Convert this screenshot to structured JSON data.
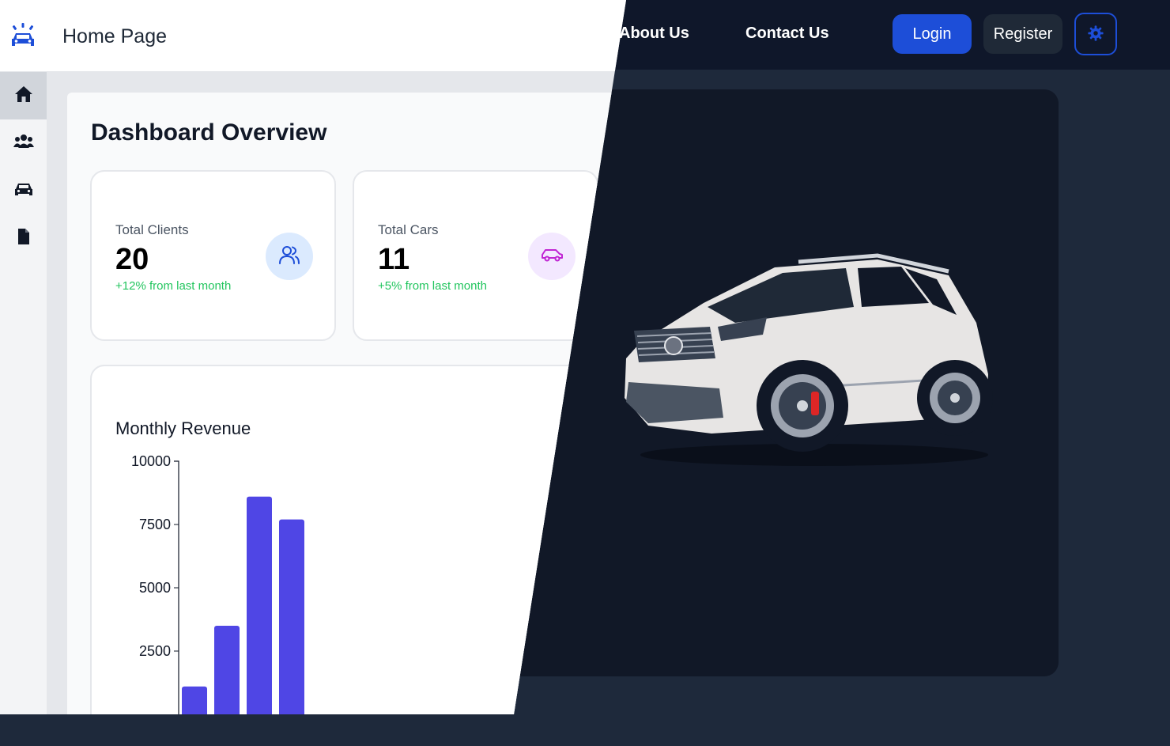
{
  "header": {
    "title": "Home Page",
    "nav": [
      {
        "label": "About Us"
      },
      {
        "label": "Contact Us"
      }
    ],
    "login_label": "Login",
    "register_label": "Register",
    "theme_icon": "gear-icon"
  },
  "sidebar": {
    "items": [
      {
        "name": "home",
        "icon": "home-icon",
        "active": true
      },
      {
        "name": "clients",
        "icon": "users-icon",
        "active": false
      },
      {
        "name": "cars",
        "icon": "car-icon",
        "active": false
      },
      {
        "name": "documents",
        "icon": "file-icon",
        "active": false
      }
    ]
  },
  "dashboard": {
    "title": "Dashboard Overview",
    "stats": [
      {
        "label": "Total Clients",
        "value": "20",
        "change": "+12% from last month",
        "icon": "users-icon"
      },
      {
        "label": "Total Cars",
        "value": "11",
        "change": "+5% from last month",
        "icon": "car-icon"
      }
    ],
    "revenue_title": "Monthly Revenue"
  },
  "chart_data": {
    "type": "bar",
    "title": "Monthly Revenue",
    "xlabel": "",
    "ylabel": "",
    "ylim": [
      0,
      10000
    ],
    "yticks": [
      10000,
      7500,
      5000,
      2500
    ],
    "values": [
      1100,
      3500,
      8600,
      7700
    ],
    "color": "#4f46e5",
    "grid": false
  },
  "colors": {
    "accent_blue": "#1d4ed8",
    "bar": "#4f46e5",
    "positive": "#22c55e",
    "dark_bg": "#1e293b",
    "dark_topbar": "#0f172a"
  }
}
